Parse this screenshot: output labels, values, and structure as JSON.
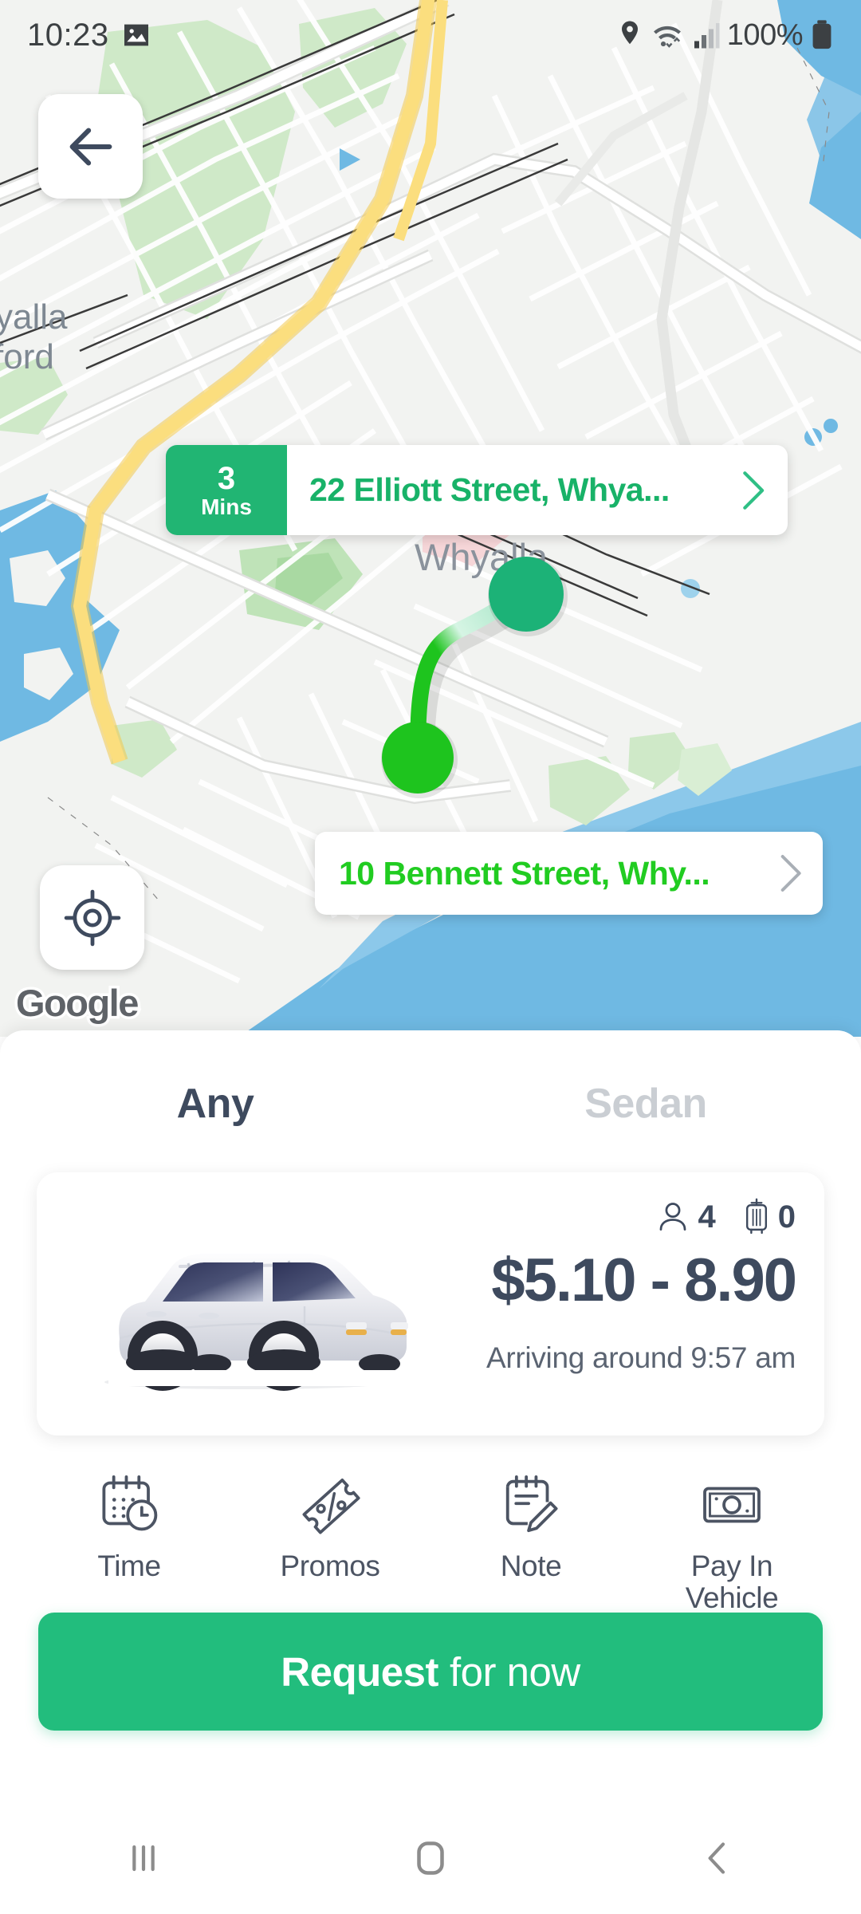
{
  "status_bar": {
    "time": "10:23",
    "battery_percent": "100%",
    "icons": [
      "image-icon",
      "location-pin-icon",
      "wifi-icon",
      "signal-bars-icon",
      "battery-icon"
    ]
  },
  "map": {
    "attribution": "Google",
    "place_label": "Whyalla",
    "edge_labels": [
      "yalla",
      "ford"
    ],
    "back_icon": "arrow-left-icon",
    "locate_icon": "crosshair-icon",
    "colors": {
      "land": "#F2F3F1",
      "water": "#6FB9E3",
      "park": "#CFE9C8",
      "highway": "#FAD96B",
      "road": "#FFFFFF",
      "route_start": "#1EC41E",
      "route_end": "#1CB277"
    }
  },
  "pickup": {
    "eta_value": "3",
    "eta_unit": "Mins",
    "address": "22 Elliott Street, Whya...",
    "chevron_icon": "chevron-right-icon",
    "badge_color": "#21B573",
    "text_color": "#18B268"
  },
  "destination": {
    "address": "10 Bennett Street, Why...",
    "chevron_icon": "chevron-right-icon",
    "text_color": "#21CC21"
  },
  "sheet": {
    "tabs": [
      {
        "label": "Any",
        "selected": true
      },
      {
        "label": "Sedan",
        "selected": false
      }
    ],
    "vehicle": {
      "image": "silver-car-illustration",
      "passenger_icon": "passenger-icon",
      "passengers": "4",
      "luggage_icon": "luggage-icon",
      "luggage": "0",
      "price": "$5.10 - 8.90",
      "arriving": "Arriving around 9:57 am"
    },
    "actions": [
      {
        "label": "Time",
        "icon": "calendar-clock-icon"
      },
      {
        "label": "Promos",
        "icon": "ticket-icon"
      },
      {
        "label": "Note",
        "icon": "note-pencil-icon"
      },
      {
        "label": "Pay In\nVehicle",
        "icon": "banknote-icon"
      }
    ],
    "request_button": {
      "bold_text": "Request",
      "light_text": "for now",
      "color": "#22BD7D"
    }
  },
  "nav_bar": {
    "recents_icon": "recents-icon",
    "home_icon": "home-icon",
    "back_icon": "nav-back-icon"
  }
}
